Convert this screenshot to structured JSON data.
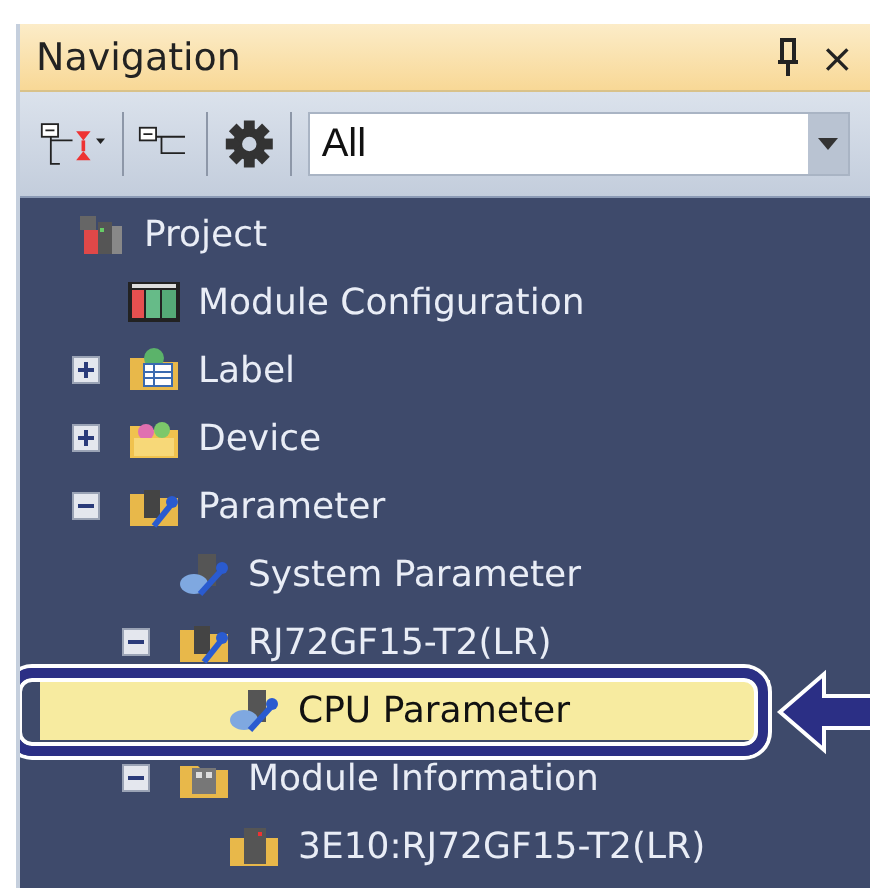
{
  "panel": {
    "title": "Navigation",
    "close": "×"
  },
  "toolbar": {
    "filter": {
      "value": "All"
    }
  },
  "tree": [
    {
      "label": "Project",
      "kind": "project",
      "selected": false,
      "children": [
        {
          "label": "Module Configuration",
          "kind": "configuration",
          "selected": false
        },
        {
          "label": "Label",
          "kind": "labels",
          "expanded": false,
          "selected": false
        },
        {
          "label": "Device",
          "kind": "devices",
          "expanded": false,
          "selected": false
        },
        {
          "label": "Parameter",
          "kind": "folder",
          "expanded": true,
          "selected": false,
          "children": [
            {
              "label": "System Parameter",
              "kind": "setting",
              "selected": false
            },
            {
              "label": "RJ72GF15-T2(LR)",
              "kind": "folder",
              "expanded": true,
              "selected": false,
              "children": [
                {
                  "label": "CPU Parameter",
                  "kind": "setting",
                  "selected": true
                }
              ]
            },
            {
              "label": "Module Information",
              "kind": "info",
              "expanded": true,
              "selected": false,
              "children": [
                {
                  "label": "3E10:RJ72GF15-T2(LR)",
                  "kind": "module",
                  "selected": false
                }
              ]
            }
          ]
        }
      ]
    }
  ]
}
